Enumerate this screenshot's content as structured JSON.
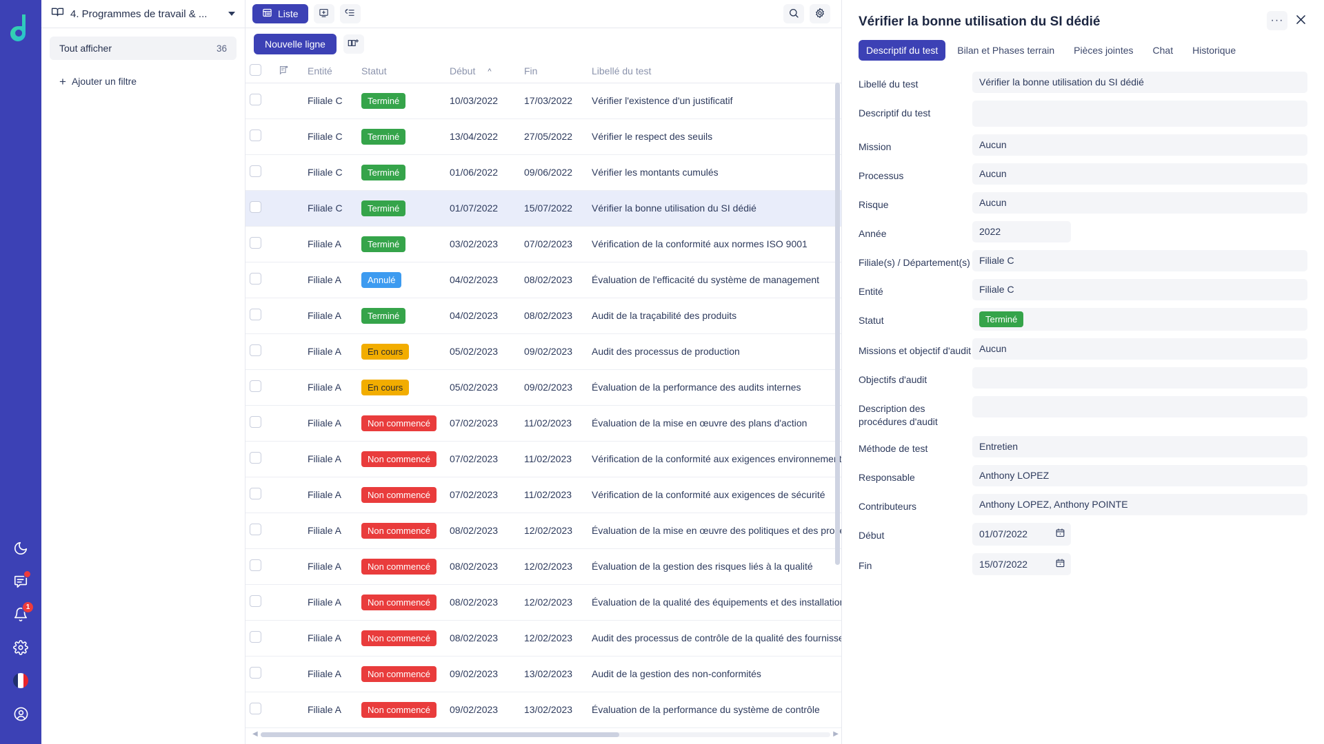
{
  "rail": {
    "logo_icon": "datakeen-logo",
    "items": [
      {
        "name": "dark-mode-toggle",
        "icon": "moon-icon",
        "badge": ""
      },
      {
        "name": "messages",
        "icon": "chat-icon",
        "badge": "dot"
      },
      {
        "name": "notifications",
        "icon": "bell-icon",
        "badge": "1"
      },
      {
        "name": "settings",
        "icon": "gear-icon",
        "badge": ""
      },
      {
        "name": "language",
        "icon": "flag-fr-icon",
        "badge": ""
      },
      {
        "name": "account",
        "icon": "user-circle-icon",
        "badge": ""
      }
    ]
  },
  "left_panel": {
    "book_icon": "book-icon",
    "title": "4. Programmes de travail & ...",
    "chevron_icon": "chevron-down-icon",
    "show_all_label": "Tout afficher",
    "show_all_count": "36",
    "add_filter_label": "Ajouter un filtre",
    "add_filter_icon": "plus-icon"
  },
  "toolbar": {
    "view_button_label": "Liste",
    "view_button_icon": "list-view-icon",
    "add_view_icon": "add-panel-icon",
    "group_icon": "group-rows-icon",
    "search_icon": "search-icon",
    "settings_icon": "gear-icon"
  },
  "subbar": {
    "new_row_label": "Nouvelle ligne",
    "add_column_icon": "add-column-icon"
  },
  "table": {
    "columns": [
      {
        "key": "checkbox",
        "label": ""
      },
      {
        "key": "comment",
        "label": "",
        "icon": "comment-note-icon"
      },
      {
        "key": "entite",
        "label": "Entité"
      },
      {
        "key": "statut",
        "label": "Statut"
      },
      {
        "key": "debut",
        "label": "Début",
        "sorted": "asc",
        "sort_icon": "chevron-up-icon"
      },
      {
        "key": "fin",
        "label": "Fin"
      },
      {
        "key": "libelle",
        "label": "Libellé du test"
      }
    ],
    "rows": [
      {
        "entite": "Filiale C",
        "statut": "Terminé",
        "statut_type": "done",
        "debut": "10/03/2022",
        "fin": "17/03/2022",
        "libelle": "Vérifier l'existence d'un justificatif",
        "selected": false
      },
      {
        "entite": "Filiale C",
        "statut": "Terminé",
        "statut_type": "done",
        "debut": "13/04/2022",
        "fin": "27/05/2022",
        "libelle": "Vérifier le respect des seuils",
        "selected": false
      },
      {
        "entite": "Filiale C",
        "statut": "Terminé",
        "statut_type": "done",
        "debut": "01/06/2022",
        "fin": "09/06/2022",
        "libelle": "Vérifier les montants cumulés",
        "selected": false
      },
      {
        "entite": "Filiale C",
        "statut": "Terminé",
        "statut_type": "done",
        "debut": "01/07/2022",
        "fin": "15/07/2022",
        "libelle": "Vérifier la bonne utilisation du SI dédié",
        "selected": true
      },
      {
        "entite": "Filiale A",
        "statut": "Terminé",
        "statut_type": "done",
        "debut": "03/02/2023",
        "fin": "07/02/2023",
        "libelle": "Vérification de la conformité aux normes ISO 9001",
        "selected": false
      },
      {
        "entite": "Filiale A",
        "statut": "Annulé",
        "statut_type": "cancel",
        "debut": "04/02/2023",
        "fin": "08/02/2023",
        "libelle": "Évaluation de l'efficacité du système de management",
        "selected": false
      },
      {
        "entite": "Filiale A",
        "statut": "Terminé",
        "statut_type": "done",
        "debut": "04/02/2023",
        "fin": "08/02/2023",
        "libelle": "Audit de la traçabilité des produits",
        "selected": false
      },
      {
        "entite": "Filiale A",
        "statut": "En cours",
        "statut_type": "prog",
        "debut": "05/02/2023",
        "fin": "09/02/2023",
        "libelle": "Audit des processus de production",
        "selected": false
      },
      {
        "entite": "Filiale A",
        "statut": "En cours",
        "statut_type": "prog",
        "debut": "05/02/2023",
        "fin": "09/02/2023",
        "libelle": "Évaluation de la performance des audits internes",
        "selected": false
      },
      {
        "entite": "Filiale A",
        "statut": "Non commencé",
        "statut_type": "todo",
        "debut": "07/02/2023",
        "fin": "11/02/2023",
        "libelle": "Évaluation de la mise en œuvre des plans d'action",
        "selected": false
      },
      {
        "entite": "Filiale A",
        "statut": "Non commencé",
        "statut_type": "todo",
        "debut": "07/02/2023",
        "fin": "11/02/2023",
        "libelle": "Vérification de la conformité aux exigences environnementales",
        "selected": false
      },
      {
        "entite": "Filiale A",
        "statut": "Non commencé",
        "statut_type": "todo",
        "debut": "07/02/2023",
        "fin": "11/02/2023",
        "libelle": "Vérification de la conformité aux exigences de sécurité",
        "selected": false
      },
      {
        "entite": "Filiale A",
        "statut": "Non commencé",
        "statut_type": "todo",
        "debut": "08/02/2023",
        "fin": "12/02/2023",
        "libelle": "Évaluation de la mise en œuvre des politiques et des procédures",
        "selected": false
      },
      {
        "entite": "Filiale A",
        "statut": "Non commencé",
        "statut_type": "todo",
        "debut": "08/02/2023",
        "fin": "12/02/2023",
        "libelle": "Évaluation de la gestion des risques liés à la qualité",
        "selected": false
      },
      {
        "entite": "Filiale A",
        "statut": "Non commencé",
        "statut_type": "todo",
        "debut": "08/02/2023",
        "fin": "12/02/2023",
        "libelle": "Évaluation de la qualité des équipements et des installations",
        "selected": false
      },
      {
        "entite": "Filiale A",
        "statut": "Non commencé",
        "statut_type": "todo",
        "debut": "08/02/2023",
        "fin": "12/02/2023",
        "libelle": "Audit des processus de contrôle de la qualité des fournisseurs",
        "selected": false
      },
      {
        "entite": "Filiale A",
        "statut": "Non commencé",
        "statut_type": "todo",
        "debut": "09/02/2023",
        "fin": "13/02/2023",
        "libelle": "Audit de la gestion des non-conformités",
        "selected": false
      },
      {
        "entite": "Filiale A",
        "statut": "Non commencé",
        "statut_type": "todo",
        "debut": "09/02/2023",
        "fin": "13/02/2023",
        "libelle": "Évaluation de la performance du système de contrôle",
        "selected": false
      }
    ]
  },
  "detail": {
    "title": "Vérifier la bonne utilisation du SI dédié",
    "more_label": "···",
    "close_icon": "close-icon",
    "tabs": [
      {
        "label": "Descriptif du test",
        "active": true
      },
      {
        "label": "Bilan et Phases terrain",
        "active": false
      },
      {
        "label": "Pièces jointes",
        "active": false
      },
      {
        "label": "Chat",
        "active": false
      },
      {
        "label": "Historique",
        "active": false
      }
    ],
    "fields": [
      {
        "label": "Libellé du test",
        "value": "Vérifier la bonne utilisation du SI dédié",
        "type": "text"
      },
      {
        "label": "Descriptif du test",
        "value": "",
        "type": "textarea"
      },
      {
        "label": "Mission",
        "value": "Aucun",
        "type": "text"
      },
      {
        "label": "Processus",
        "value": "Aucun",
        "type": "text"
      },
      {
        "label": "Risque",
        "value": "Aucun",
        "type": "text"
      },
      {
        "label": "Année",
        "value": "2022",
        "type": "small"
      },
      {
        "label": "Filiale(s) / Département(s)",
        "value": "Filiale C",
        "type": "text"
      },
      {
        "label": "Entité",
        "value": "Filiale C",
        "type": "text"
      },
      {
        "label": "Statut",
        "value": "Terminé",
        "type": "chip",
        "chip_type": "done"
      },
      {
        "label": "Missions et objectif d'audit",
        "value": "Aucun",
        "type": "text"
      },
      {
        "label": "Objectifs d'audit",
        "value": "",
        "type": "text"
      },
      {
        "label": "Description des procédures d'audit",
        "value": "",
        "type": "text"
      },
      {
        "label": "Méthode de test",
        "value": "Entretien",
        "type": "text"
      },
      {
        "label": "Responsable",
        "value": "Anthony LOPEZ",
        "type": "text"
      },
      {
        "label": "Contributeurs",
        "value": "Anthony LOPEZ, Anthony POINTE",
        "type": "text"
      },
      {
        "label": "Début",
        "value": "01/07/2022",
        "type": "date",
        "icon": "calendar-icon"
      },
      {
        "label": "Fin",
        "value": "15/07/2022",
        "type": "date",
        "icon": "calendar-icon"
      }
    ]
  },
  "colors": {
    "brand": "#3c41b5",
    "done": "#35a44a",
    "cancel": "#3d9bf0",
    "in_progress": "#f2ad00",
    "not_started": "#e93c3c",
    "selected_row": "#e9edfa"
  }
}
